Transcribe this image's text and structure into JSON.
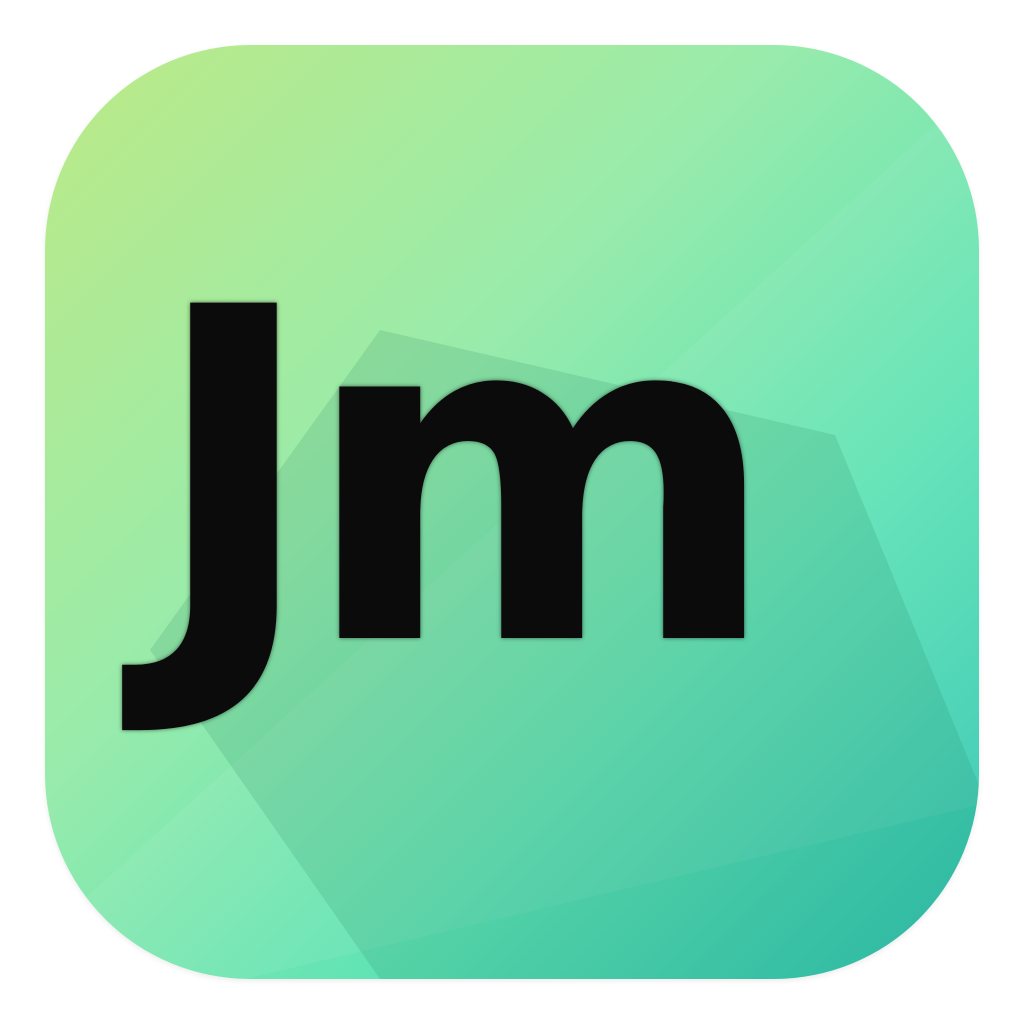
{
  "icon": {
    "name": "app-icon",
    "monogram": "Jm"
  },
  "colors": {
    "gradient_top_left": "#bdea86",
    "gradient_middle": "#98ebac",
    "gradient_bottom_right": "#2dc3b3",
    "letter": "#0b0b0b",
    "long_shadow": "#1e7e5a"
  }
}
